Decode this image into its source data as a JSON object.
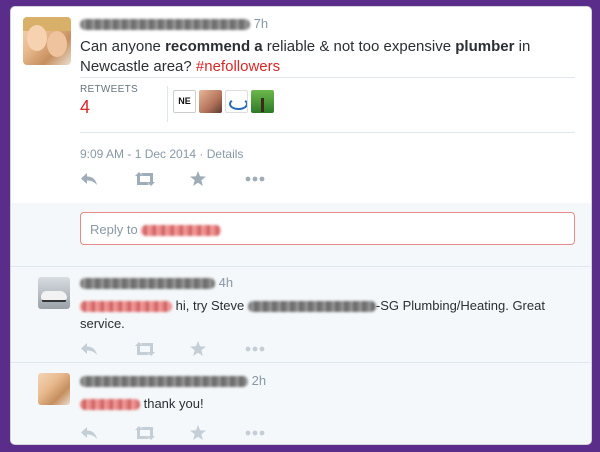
{
  "main_tweet": {
    "time_ago": "7h",
    "text_parts": [
      {
        "t": "Can anyone ",
        "bold": false
      },
      {
        "t": "recommend a",
        "bold": true
      },
      {
        "t": " reliable & not too expensive ",
        "bold": false
      },
      {
        "t": "plumber",
        "bold": true
      },
      {
        "t": " in Newcastle area? ",
        "bold": false
      }
    ],
    "hashtag": "#nefollowers",
    "retweets_label": "RETWEETS",
    "retweets_count": "4",
    "retweeter_avatars": [
      "NE",
      "",
      "",
      ""
    ],
    "timestamp": "9:09 AM - 1 Dec 2014",
    "meta_sep": " · ",
    "details_label": "Details"
  },
  "reply_box": {
    "placeholder": "Reply to"
  },
  "replies": [
    {
      "time_ago": "4h",
      "text_mid": " hi, try Steve ",
      "text_end": "-SG Plumbing/Heating. Great service."
    },
    {
      "time_ago": "2h",
      "text_end": " thank you!"
    }
  ],
  "icons": {
    "reply": "reply-icon",
    "retweet": "retweet-icon",
    "favorite": "star-icon",
    "more": "more-icon"
  },
  "colors": {
    "accent": "#d82828",
    "background": "#5b2d8a",
    "icon": "#9fadb8"
  }
}
